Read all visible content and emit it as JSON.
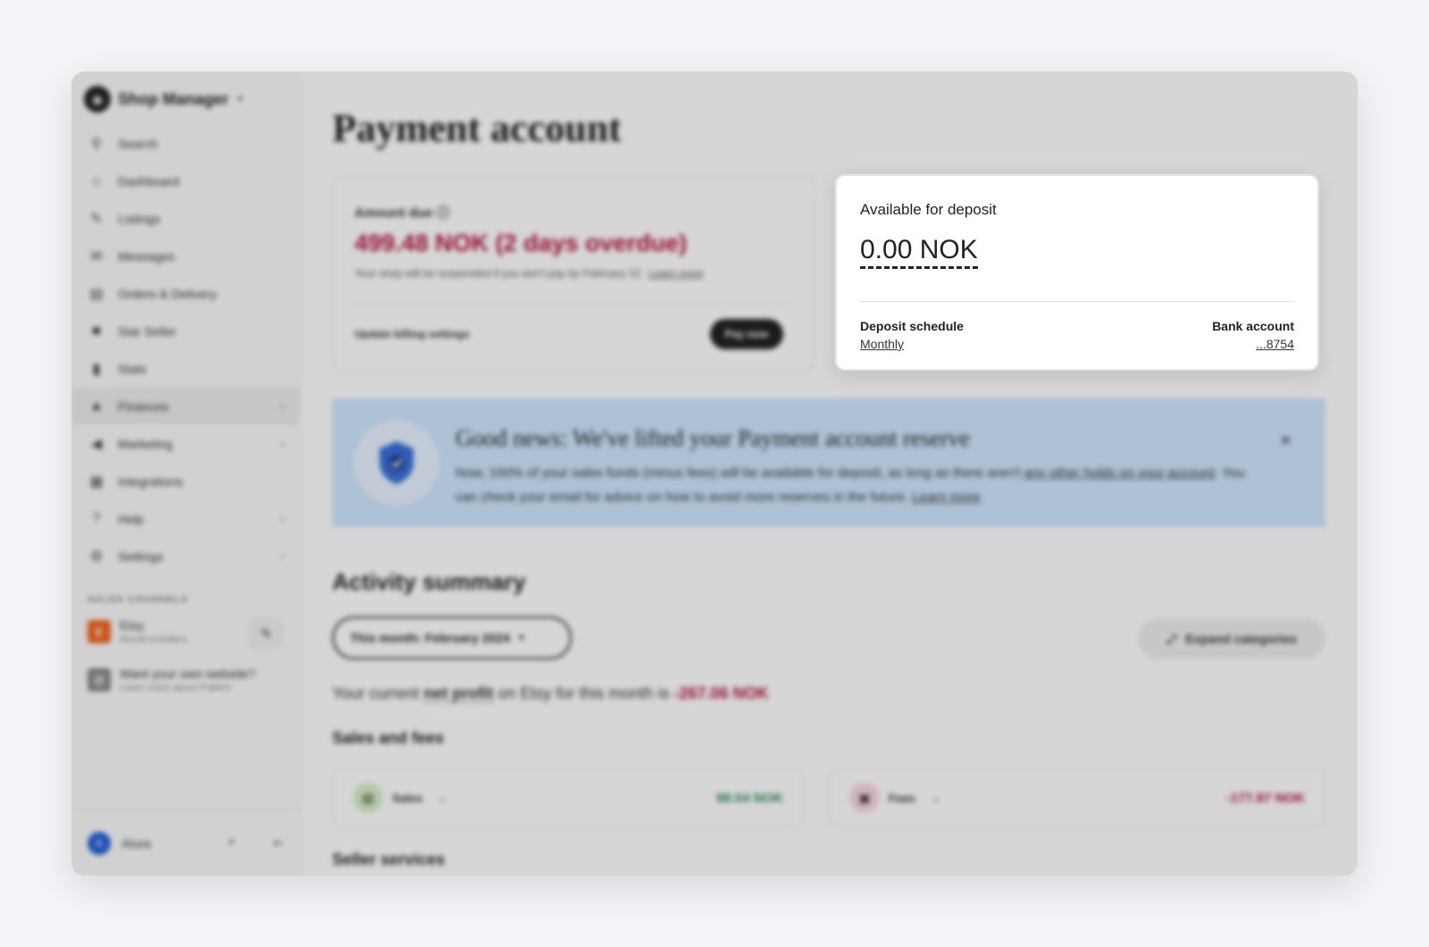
{
  "sidebar": {
    "shop_title": "Shop Manager",
    "items": [
      {
        "label": "Search",
        "icon": "search-icon"
      },
      {
        "label": "Dashboard",
        "icon": "home-icon"
      },
      {
        "label": "Listings",
        "icon": "listings-icon"
      },
      {
        "label": "Messages",
        "icon": "messages-icon"
      },
      {
        "label": "Orders & Delivery",
        "icon": "orders-icon"
      },
      {
        "label": "Star Seller",
        "icon": "star-seller-icon"
      },
      {
        "label": "Stats",
        "icon": "stats-icon"
      },
      {
        "label": "Finances",
        "icon": "bank-icon"
      },
      {
        "label": "Marketing",
        "icon": "megaphone-icon"
      },
      {
        "label": "Integrations",
        "icon": "grid-icon"
      },
      {
        "label": "Help",
        "icon": "help-icon"
      },
      {
        "label": "Settings",
        "icon": "gear-icon"
      }
    ],
    "sales_channels_label": "SALES CHANNELS",
    "etsy_channel": {
      "badge": "E",
      "name": "Etsy",
      "handle": "AluraForSellers"
    },
    "pattern": {
      "title": "Want your own website?",
      "subtitle": "Learn more about Pattern"
    },
    "user": {
      "initial": "A",
      "name": "Alura"
    }
  },
  "main": {
    "page_title": "Payment account",
    "amount_due": {
      "label": "Amount due",
      "amount": "499.48 NOK (2 days overdue)",
      "note": "Your shop will be suspended if you don't pay by February 22.",
      "learn_more": "Learn more",
      "billing_link": "Update billing settings",
      "pay_button": "Pay now"
    },
    "deposit": {
      "label": "Available for deposit",
      "amount": "0.00 NOK",
      "schedule_label": "Deposit schedule",
      "schedule_value": "Monthly",
      "bank_label": "Bank account",
      "bank_value": "...8754"
    },
    "banner": {
      "title": "Good news: We've lifted your Payment account reserve",
      "text_1": "Now, 100% of your sales funds (minus fees) will be available for deposit, as long as there aren't",
      "link_1": "any other holds on your account",
      "text_2": ". You can check your email for advice on how to avoid more reserves in the future.",
      "link_2": "Learn more",
      "close": "×"
    },
    "activity": {
      "title": "Activity summary",
      "month_select": "This month: February 2024",
      "expand_button": "Expand categories",
      "net_profit_prefix": "Your current",
      "net_profit_link": "net profit",
      "net_profit_middle": "on Etsy for this month is",
      "net_profit_value": "-267.06 NOK",
      "sales_fees_title": "Sales and fees",
      "sales_label": "Sales",
      "sales_value": "98.04 NOK",
      "fees_label": "Fees",
      "fees_value": "-177.87 NOK",
      "seller_services_title": "Seller services"
    }
  },
  "colors": {
    "overdue": "#b3133b",
    "positive": "#2e8b57",
    "banner": "#cfe7ff",
    "etsy": "#f1641e"
  }
}
